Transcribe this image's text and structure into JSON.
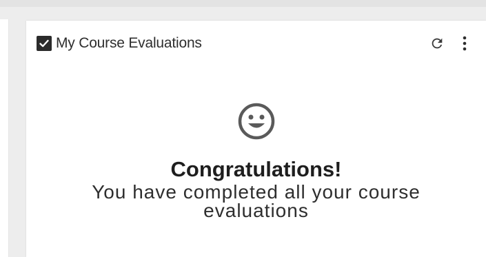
{
  "widget": {
    "title": "My Course Evaluations",
    "checked": true,
    "actions": [
      {
        "name": "refresh",
        "icon": "refresh-icon"
      },
      {
        "name": "more",
        "icon": "more-vertical-icon"
      }
    ]
  },
  "empty_state": {
    "icon": "smiley-face-icon",
    "headline": "Congratulations!",
    "message": "You have completed all your course evaluations"
  },
  "colors": {
    "page_background": "#ededed",
    "card_background": "#ffffff",
    "text_dark": "#1e1e1e",
    "icon_gray": "#5a5a5a"
  }
}
